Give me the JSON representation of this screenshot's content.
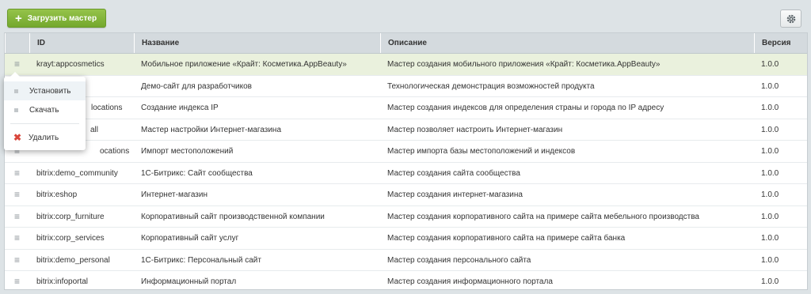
{
  "toolbar": {
    "upload_label": "Загрузить мастер"
  },
  "columns": {
    "id": "ID",
    "name": "Название",
    "description": "Описание",
    "version": "Версия"
  },
  "rows": [
    {
      "id": "krayt:appcosmetics",
      "name": "Мобильное приложение «Крайт: Косметика.AppBeauty»",
      "description": "Мастер создания мобильного приложения «Крайт: Косметика.AppBeauty»",
      "version": "1.0.0"
    },
    {
      "id": "",
      "name": "Демо-сайт для разработчиков",
      "description": "Технологическая демонстрация возможностей продукта",
      "version": "1.0.0"
    },
    {
      "id": "locations",
      "name": "Создание индекса IP",
      "description": "Мастер создания индексов для определения страны и города по IP адресу",
      "version": "1.0.0"
    },
    {
      "id": "all",
      "name": "Мастер настройки Интернет-магазина",
      "description": "Мастер позволяет настроить Интернет-магазин",
      "version": "1.0.0"
    },
    {
      "id": "ocations",
      "name": "Импорт местоположений",
      "description": "Мастер импорта базы местоположений и индексов",
      "version": "1.0.0"
    },
    {
      "id": "bitrix:demo_community",
      "name": "1С-Битрикс: Сайт сообщества",
      "description": "Мастер создания сайта сообщества",
      "version": "1.0.0"
    },
    {
      "id": "bitrix:eshop",
      "name": "Интернет-магазин",
      "description": "Мастер создания интернет-магазина",
      "version": "1.0.0"
    },
    {
      "id": "bitrix:corp_furniture",
      "name": "Корпоративный сайт производственной компании",
      "description": "Мастер создания корпоративного сайта на примере сайта мебельного производства",
      "version": "1.0.0"
    },
    {
      "id": "bitrix:corp_services",
      "name": "Корпоративный сайт услуг",
      "description": "Мастер создания корпоративного сайта на примере сайта банка",
      "version": "1.0.0"
    },
    {
      "id": "bitrix:demo_personal",
      "name": "1С-Битрикс: Персональный сайт",
      "description": "Мастер создания персонального сайта",
      "version": "1.0.0"
    },
    {
      "id": "bitrix:infoportal",
      "name": "Информационный портал",
      "description": "Мастер создания информационного портала",
      "version": "1.0.0"
    }
  ],
  "context_menu": {
    "install": "Установить",
    "download": "Скачать",
    "delete": "Удалить"
  },
  "icons": {
    "row_menu": "hamburger-icon",
    "settings": "gear-icon",
    "add": "plus-icon",
    "delete": "cross-icon"
  },
  "colors": {
    "accent_green": "#7fb13a",
    "selected_row": "#eaf1dd",
    "delete_red": "#d9463b"
  }
}
